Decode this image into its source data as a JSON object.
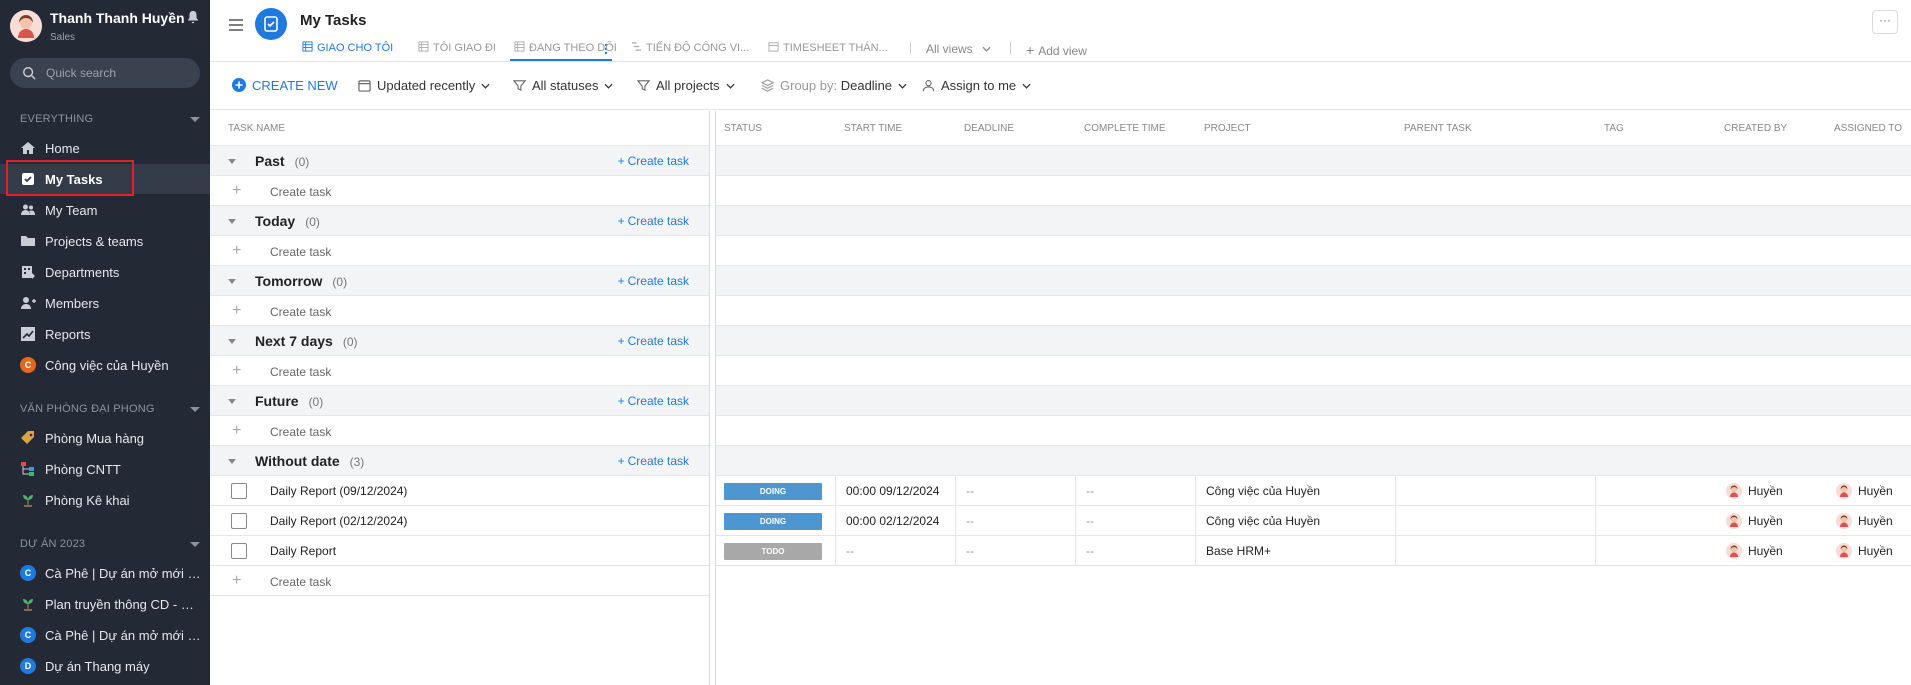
{
  "sidebar": {
    "user_name": "Thanh Thanh Huyền",
    "user_role": "Sales",
    "search_placeholder": "Quick search",
    "section_everything": "EVERYTHING",
    "items": [
      {
        "label": "Home",
        "icon": "home-icon"
      },
      {
        "label": "My Tasks",
        "icon": "task-check-icon"
      },
      {
        "label": "My Team",
        "icon": "team-icon"
      },
      {
        "label": "Projects & teams",
        "icon": "folder-icon"
      },
      {
        "label": "Departments",
        "icon": "department-icon"
      },
      {
        "label": "Members",
        "icon": "add-member-icon"
      },
      {
        "label": "Reports",
        "icon": "reports-icon"
      },
      {
        "label": "Công việc của Huyền",
        "badge": "C",
        "badge_color": "#e8671f"
      }
    ],
    "section_office": "VĂN PHÒNG ĐẠI PHONG",
    "office_items": [
      {
        "label": "Phòng Mua hàng",
        "icon": "tag-icon"
      },
      {
        "label": "Phòng CNTT",
        "icon": "hierarchy-icon"
      },
      {
        "label": "Phòng Kê khai",
        "icon": "plant-icon"
      }
    ],
    "section_projects": "DỰ ÁN 2023",
    "project_items": [
      {
        "label": "Cà Phê | Dự án mở mới c...",
        "badge": "C",
        "badge_color": "#1f7ae0"
      },
      {
        "label": "Plan truyền thông CD - M...",
        "icon": "plant-icon"
      },
      {
        "label": "Cà Phê | Dự án mở mới V...",
        "badge": "C",
        "badge_color": "#1f7ae0"
      },
      {
        "label": "Dự án Thang máy",
        "badge": "D",
        "badge_color": "#1f7ae0"
      }
    ]
  },
  "header": {
    "title": "My Tasks",
    "tabs": [
      {
        "label": "GIAO CHO TÔI"
      },
      {
        "label": "TÔI GIAO ĐI"
      },
      {
        "label": "ĐANG THEO DÕI"
      },
      {
        "label": "TIẾN ĐỘ CÔNG VI..."
      },
      {
        "label": "TIMESHEET THÁN..."
      }
    ],
    "all_views": "All views",
    "add_view": "Add view",
    "more": "···"
  },
  "toolbar": {
    "create_new": "CREATE NEW",
    "sort": "Updated recently",
    "statuses": "All statuses",
    "projects": "All projects",
    "group_by_label": "Group by:",
    "group_by_value": "Deadline",
    "assign": "Assign to me"
  },
  "columns": {
    "task_name": "TASK NAME",
    "status": "STATUS",
    "start_time": "START TIME",
    "deadline": "DEADLINE",
    "complete_time": "COMPLETE TIME",
    "project": "PROJECT",
    "parent_task": "PARENT TASK",
    "tag": "TAG",
    "created_by": "CREATED BY",
    "assigned_to": "ASSIGNED TO"
  },
  "create_task_label": "Create task",
  "groups": [
    {
      "name": "Past",
      "count": "(0)"
    },
    {
      "name": "Today",
      "count": "(0)"
    },
    {
      "name": "Tomorrow",
      "count": "(0)"
    },
    {
      "name": "Next 7 days",
      "count": "(0)"
    },
    {
      "name": "Future",
      "count": "(0)"
    },
    {
      "name": "Without date",
      "count": "(3)"
    }
  ],
  "tasks": [
    {
      "name": "Daily Report (09/12/2024)",
      "status": "DOING",
      "status_color": "#4d96cf",
      "start_time": "00:00 09/12/2024",
      "deadline": "--",
      "complete_time": "--",
      "project": "Công việc của Huyền",
      "created_by": "Huyền",
      "assigned_to": "Huyền"
    },
    {
      "name": "Daily Report (02/12/2024)",
      "status": "DOING",
      "status_color": "#4d96cf",
      "start_time": "00:00 02/12/2024",
      "deadline": "--",
      "complete_time": "--",
      "project": "Công việc của Huyền",
      "created_by": "Huyền",
      "assigned_to": "Huyền"
    },
    {
      "name": "Daily Report",
      "status": "TODO",
      "status_color": "#a8a8a8",
      "start_time": "--",
      "deadline": "--",
      "complete_time": "--",
      "project": "Base HRM+",
      "created_by": "Huyền",
      "assigned_to": "Huyền"
    }
  ]
}
